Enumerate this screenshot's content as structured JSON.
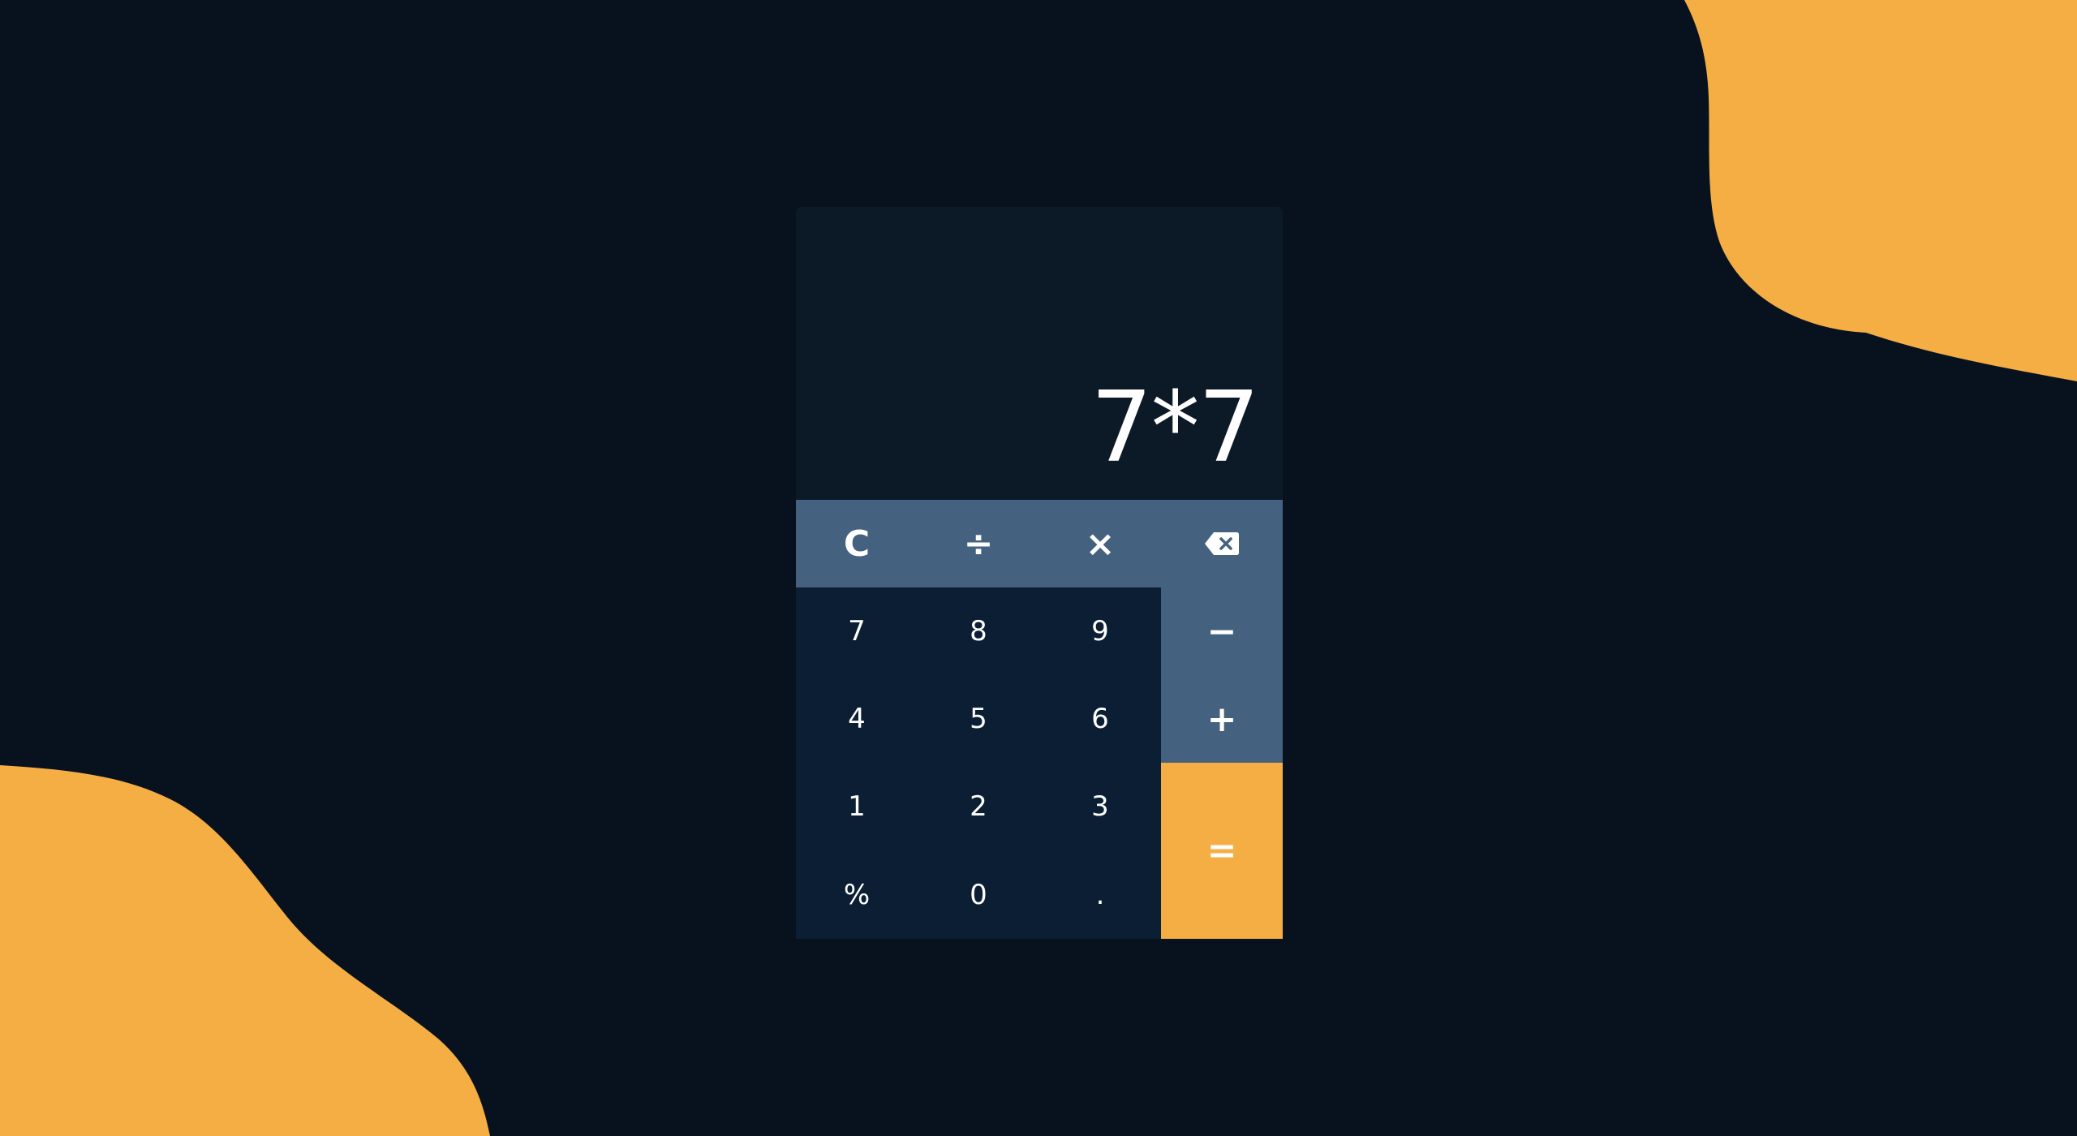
{
  "colors": {
    "background": "#08121f",
    "accent": "#f5ae44",
    "operator_key": "#44617f",
    "number_key": "#0b1e33",
    "display": "#0c1a28",
    "text": "#ffffff"
  },
  "display": {
    "value": "7*7"
  },
  "keys": {
    "clear": "C",
    "divide": "÷",
    "multiply": "×",
    "backspace_icon": "backspace-icon",
    "subtract": "−",
    "add": "+",
    "equals": "=",
    "seven": "7",
    "eight": "8",
    "nine": "9",
    "four": "4",
    "five": "5",
    "six": "6",
    "one": "1",
    "two": "2",
    "three": "3",
    "percent": "%",
    "zero": "0",
    "decimal": "."
  }
}
